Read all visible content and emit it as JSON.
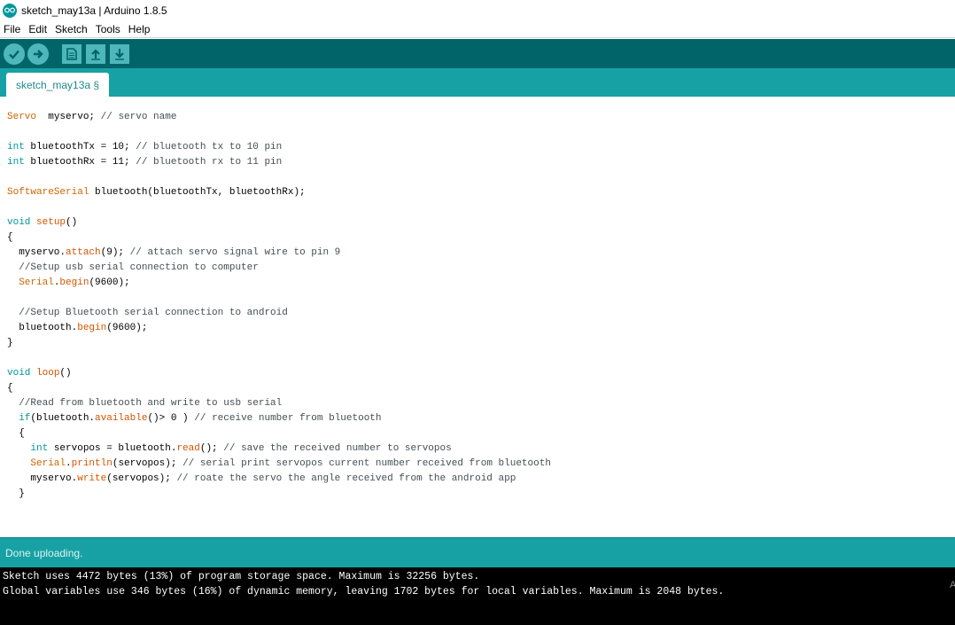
{
  "window": {
    "title": "sketch_may13a | Arduino 1.8.5",
    "logo_icon": "arduino-logo-icon"
  },
  "menu": [
    "File",
    "Edit",
    "Sketch",
    "Tools",
    "Help"
  ],
  "toolbar": {
    "buttons": [
      {
        "name": "verify",
        "icon": "checkmark-icon"
      },
      {
        "name": "upload",
        "icon": "arrow-right-icon"
      },
      {
        "name": "new",
        "icon": "new-file-icon"
      },
      {
        "name": "open",
        "icon": "arrow-up-icon"
      },
      {
        "name": "save",
        "icon": "arrow-down-icon"
      }
    ]
  },
  "tab": {
    "label": "sketch_may13a §"
  },
  "code": {
    "lines": [
      [
        [
          "ty",
          "Servo"
        ],
        [
          "",
          "  myservo; "
        ],
        [
          "cm",
          "// servo name"
        ]
      ],
      [],
      [
        [
          "kw",
          "int"
        ],
        [
          "",
          " bluetoothTx = 10; "
        ],
        [
          "cm",
          "// bluetooth tx to 10 pin"
        ]
      ],
      [
        [
          "kw",
          "int"
        ],
        [
          "",
          " bluetoothRx = 11; "
        ],
        [
          "cm",
          "// bluetooth rx to 11 pin"
        ]
      ],
      [],
      [
        [
          "ty",
          "SoftwareSerial"
        ],
        [
          "",
          " bluetooth(bluetoothTx, bluetoothRx);"
        ]
      ],
      [],
      [
        [
          "kw",
          "void"
        ],
        [
          "",
          " "
        ],
        [
          "fn",
          "setup"
        ],
        [
          "",
          "()"
        ]
      ],
      [
        [
          "",
          "{"
        ]
      ],
      [
        [
          "",
          "  myservo."
        ],
        [
          "fn",
          "attach"
        ],
        [
          "",
          "(9); "
        ],
        [
          "cm",
          "// attach servo signal wire to pin 9"
        ]
      ],
      [
        [
          "cm",
          "  //Setup usb serial connection to computer"
        ]
      ],
      [
        [
          "",
          "  "
        ],
        [
          "ty",
          "Serial"
        ],
        [
          "",
          "."
        ],
        [
          "fn",
          "begin"
        ],
        [
          "",
          "(9600);"
        ]
      ],
      [],
      [
        [
          "cm",
          "  //Setup Bluetooth serial connection to android"
        ]
      ],
      [
        [
          "",
          "  bluetooth."
        ],
        [
          "fn",
          "begin"
        ],
        [
          "",
          "(9600);"
        ]
      ],
      [
        [
          "",
          "}"
        ]
      ],
      [],
      [
        [
          "kw",
          "void"
        ],
        [
          "",
          " "
        ],
        [
          "fn",
          "loop"
        ],
        [
          "",
          "()"
        ]
      ],
      [
        [
          "",
          "{"
        ]
      ],
      [
        [
          "cm",
          "  //Read from bluetooth and write to usb serial"
        ]
      ],
      [
        [
          "",
          "  "
        ],
        [
          "kw",
          "if"
        ],
        [
          "",
          "(bluetooth."
        ],
        [
          "fn",
          "available"
        ],
        [
          "",
          "()> 0 ) "
        ],
        [
          "cm",
          "// receive number from bluetooth"
        ]
      ],
      [
        [
          "",
          "  {"
        ]
      ],
      [
        [
          "",
          "    "
        ],
        [
          "kw",
          "int"
        ],
        [
          "",
          " servopos = bluetooth."
        ],
        [
          "fn",
          "read"
        ],
        [
          "",
          "(); "
        ],
        [
          "cm",
          "// save the received number to servopos"
        ]
      ],
      [
        [
          "",
          "    "
        ],
        [
          "ty",
          "Serial"
        ],
        [
          "",
          "."
        ],
        [
          "fn",
          "println"
        ],
        [
          "",
          "(servopos); "
        ],
        [
          "cm",
          "// serial print servopos current number received from bluetooth"
        ]
      ],
      [
        [
          "",
          "    myservo."
        ],
        [
          "fn",
          "write"
        ],
        [
          "",
          "(servopos); "
        ],
        [
          "cm",
          "// roate the servo the angle received from the android app"
        ]
      ],
      [
        [
          "",
          "  }"
        ]
      ]
    ]
  },
  "status": {
    "text": "Done uploading."
  },
  "console": {
    "lines": [
      "Sketch uses 4472 bytes (13%) of program storage space. Maximum is 32256 bytes.",
      "Global variables use 346 bytes (16%) of dynamic memory, leaving 1702 bytes for local variables. Maximum is 2048 bytes."
    ],
    "side_text": "A"
  },
  "colors": {
    "toolbar": "#006468",
    "tabbar": "#17a1a5",
    "keyword": "#00979c",
    "type": "#cc6600",
    "comment": "#434f54"
  }
}
